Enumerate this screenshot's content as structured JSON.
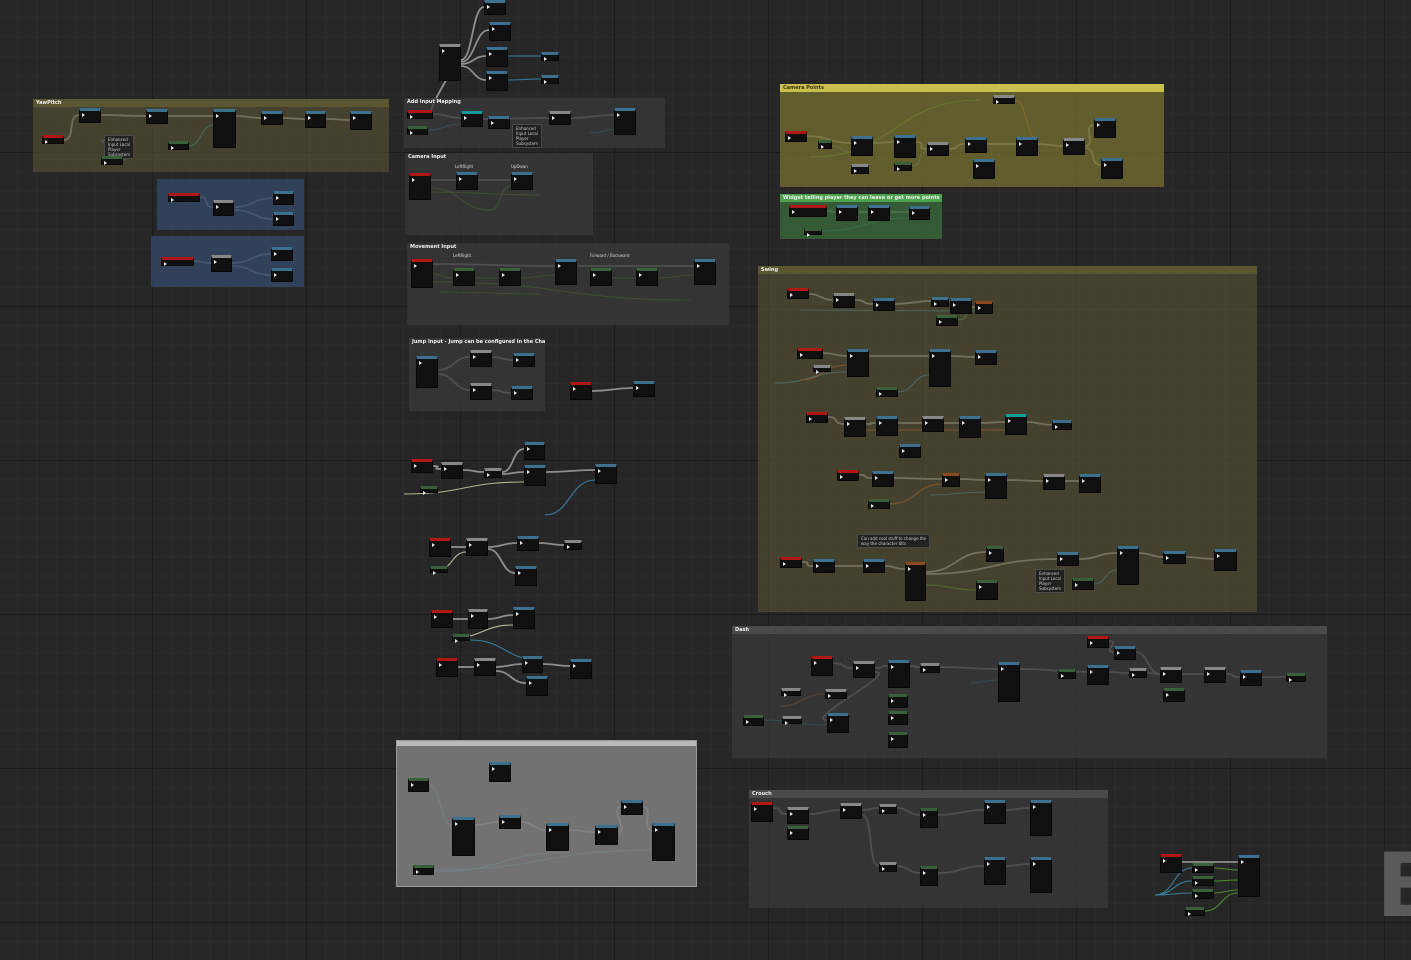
{
  "comments": {
    "yaw_pitch": "YawPitch",
    "add_input_mapping": "Add Input Mapping",
    "camera_input": "Camera Input",
    "movement_input": "Movement Input",
    "jump_input": "Jump Input - Jump can be configured in the CharacterMovementComponent",
    "camera_points": "Camera Points",
    "widget_block": "Widget telling player they can leave or get more points",
    "swing": "Swing",
    "dash": "Dash",
    "crouch": "Crouch"
  },
  "labels": {
    "left_right_cam": "LeftRight",
    "up_down": "UpDown",
    "left_right_move": "LeftRight",
    "forward_backward": "Forward / Backward",
    "enhanced_top": "Enhanced\nInput Local\nPlayer\nSubsystem",
    "enhanced_mapping": "Enhanced\nInput Local\nPlayer\nSubsystem",
    "enhanced_swing": "Enhanced\nInput Local\nPlayer\nSubsystem",
    "swing_note": "Can add cool stuff to change the\nway the character tilts"
  },
  "watermark": "B",
  "colors": {
    "exec_wire": "#9a9a9a",
    "data_wire_blue": "#3a86a8",
    "data_wire_green": "#4f9a2a",
    "data_wire_orange": "#b8642a",
    "event_red": "#b01818"
  }
}
